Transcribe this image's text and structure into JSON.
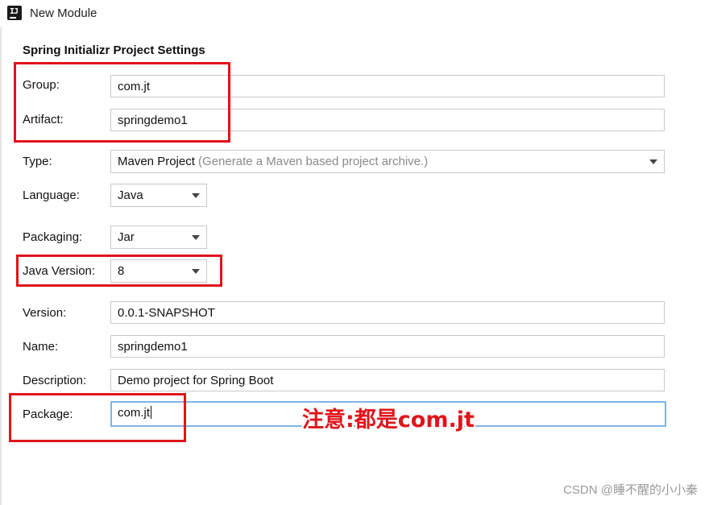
{
  "window": {
    "title": "New Module"
  },
  "section_title": "Spring Initializr Project Settings",
  "fields": {
    "group": {
      "label": "Group:",
      "value": "com.jt"
    },
    "artifact": {
      "label": "Artifact:",
      "value": "springdemo1"
    },
    "type": {
      "label": "Type:",
      "value": "Maven Project",
      "hint": " (Generate a Maven based project archive.)"
    },
    "language": {
      "label": "Language:",
      "value": "Java"
    },
    "packaging": {
      "label": "Packaging:",
      "value": "Jar"
    },
    "java_version": {
      "label": "Java Version:",
      "value": "8"
    },
    "version": {
      "label": "Version:",
      "value": "0.0.1-SNAPSHOT"
    },
    "name": {
      "label": "Name:",
      "value": "springdemo1"
    },
    "description": {
      "label": "Description:",
      "value": "Demo project for Spring Boot"
    },
    "package": {
      "label": "Package:",
      "value": "com.jt"
    }
  },
  "annotation": "注意:都是com.jt",
  "watermark": "CSDN @睡不醒的小小秦",
  "colors": {
    "highlight": "#e0141b",
    "focus_border": "#7fb4e6"
  }
}
